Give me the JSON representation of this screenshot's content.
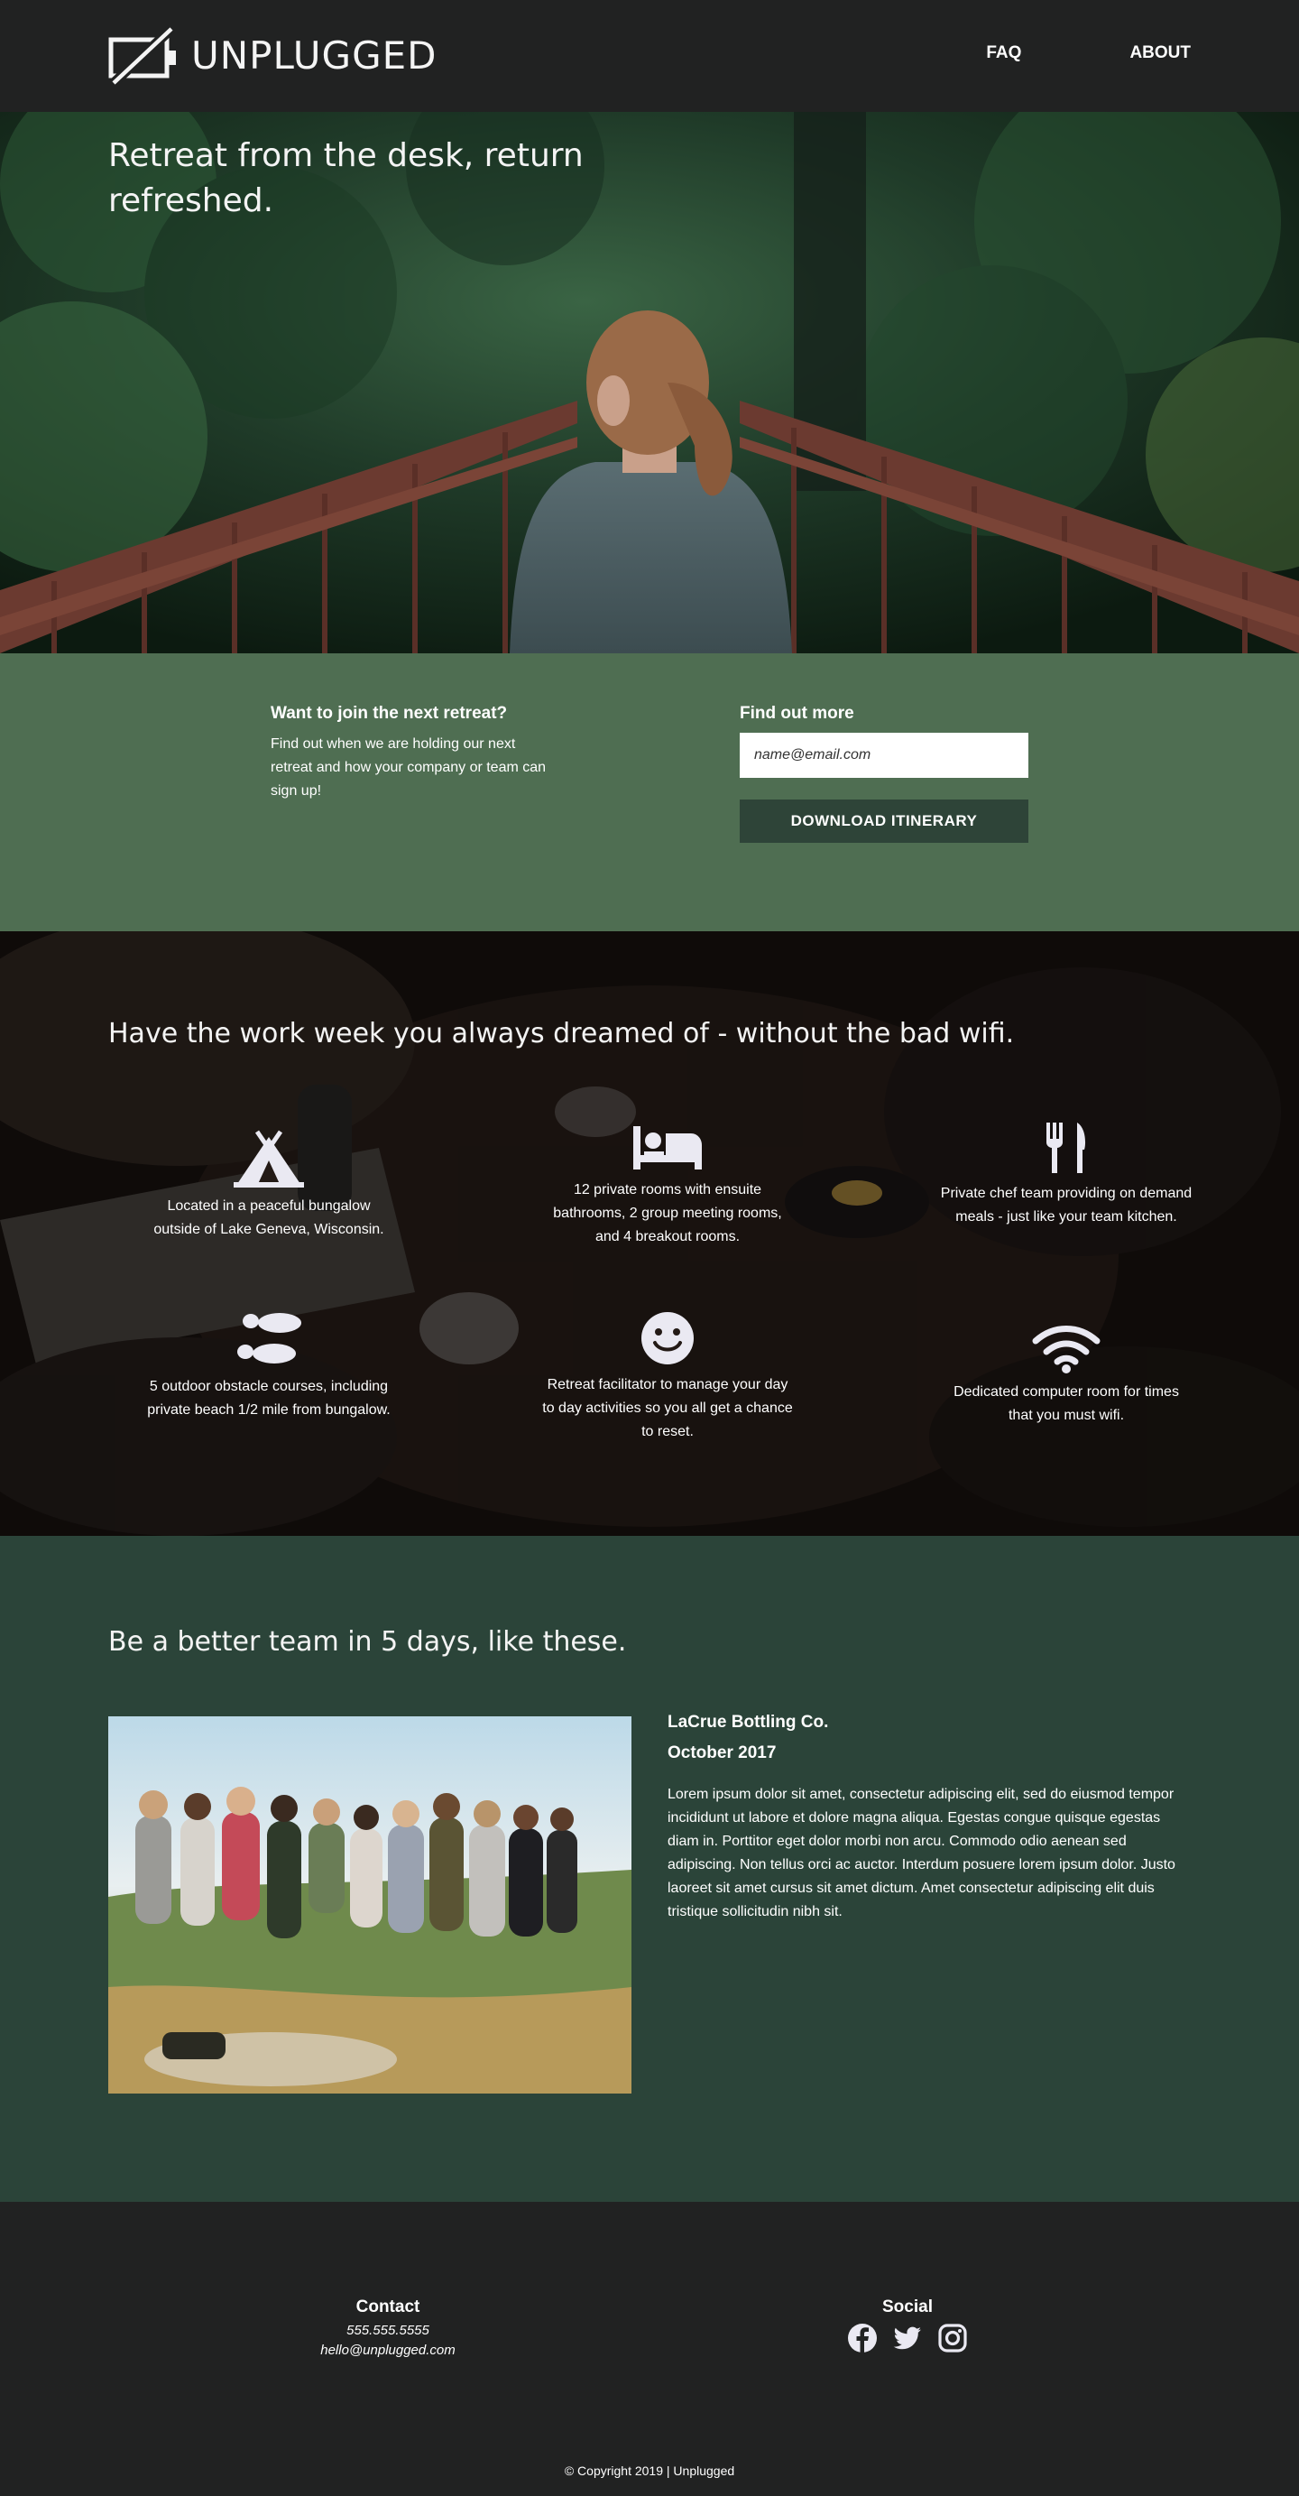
{
  "header": {
    "logo_text": "UNPLUGGED",
    "nav": [
      {
        "label": "FAQ"
      },
      {
        "label": "ABOUT"
      }
    ]
  },
  "hero": {
    "title": "Retreat from the desk, return refreshed."
  },
  "signup": {
    "heading": "Want to join the next retreat?",
    "body": "Find out when we are holding our next retreat and how your company or team can sign up!",
    "form_heading": "Find out more",
    "email_placeholder": "name@email.com",
    "button_label": "DOWNLOAD ITINERARY"
  },
  "features": {
    "title": "Have the work week you always dreamed of - without the bad wifi.",
    "items": [
      {
        "icon": "tent-icon",
        "text": "Located in a peaceful bungalow outside of Lake Geneva, Wisconsin."
      },
      {
        "icon": "bed-icon",
        "text": "12 private rooms with ensuite bathrooms, 2 group meeting rooms, and 4 breakout rooms."
      },
      {
        "icon": "utensils-icon",
        "text": "Private chef team providing on demand meals - just like your team kitchen."
      },
      {
        "icon": "footprints-icon",
        "text": "5 outdoor obstacle courses, including private beach 1/2 mile from bungalow."
      },
      {
        "icon": "smile-icon",
        "text": "Retreat facilitator to manage your day to day activities so you all get a chance to reset."
      },
      {
        "icon": "wifi-icon",
        "text": "Dedicated computer room for times that you must wifi."
      }
    ]
  },
  "team": {
    "title": "Be a better team in 5 days, like these.",
    "company": "LaCrue Bottling Co.",
    "date": "October 2017",
    "text": "Lorem ipsum dolor sit amet, consectetur adipiscing elit, sed do eiusmod tempor incididunt ut labore et dolore magna aliqua. Egestas congue quisque egestas diam in. Porttitor eget dolor morbi non arcu. Commodo odio aenean sed adipiscing. Non tellus orci ac auctor. Interdum posuere lorem ipsum dolor. Justo laoreet sit amet cursus sit amet dictum. Amet consectetur adipiscing elit duis tristique sollicitudin nibh sit."
  },
  "footer": {
    "contact_heading": "Contact",
    "phone": "555.555.5555",
    "email": "hello@unplugged.com",
    "social_heading": "Social",
    "social": [
      "facebook-icon",
      "twitter-icon",
      "instagram-icon"
    ],
    "copyright": "©  Copyright 2019  |  Unplugged"
  }
}
